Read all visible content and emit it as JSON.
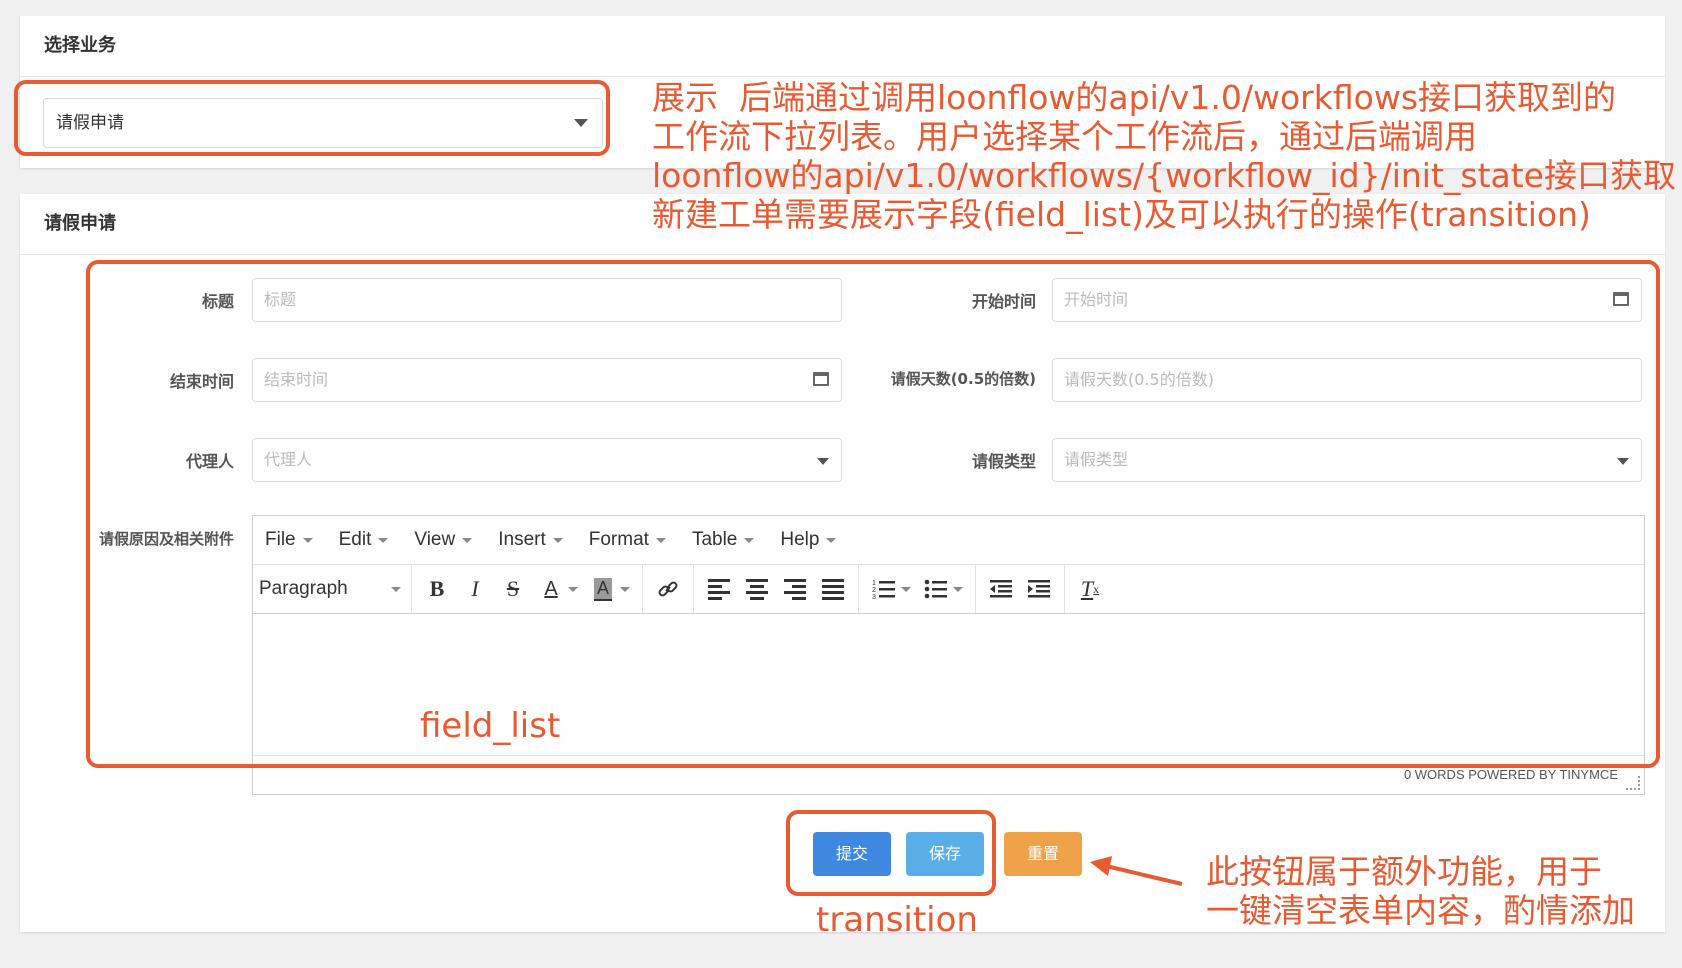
{
  "select_panel": {
    "title": "选择业务",
    "selected_value": "请假申请"
  },
  "form_panel": {
    "title": "请假申请",
    "fields": {
      "title": {
        "label": "标题",
        "placeholder": "标题"
      },
      "start_time": {
        "label": "开始时间",
        "placeholder": "开始时间"
      },
      "end_time": {
        "label": "结束时间",
        "placeholder": "结束时间"
      },
      "leave_days": {
        "label": "请假天数(0.5的倍数)",
        "placeholder": "请假天数(0.5的倍数)"
      },
      "agent": {
        "label": "代理人",
        "placeholder": "代理人"
      },
      "leave_type": {
        "label": "请假类型",
        "placeholder": "请假类型"
      },
      "reason": {
        "label": "请假原因及相关附件"
      }
    },
    "editor": {
      "menus": [
        "File",
        "Edit",
        "View",
        "Insert",
        "Format",
        "Table",
        "Help"
      ],
      "block_format": "Paragraph",
      "status": "0 WORDS POWERED BY TINYMCE"
    },
    "buttons": {
      "submit": "提交",
      "save": "保存",
      "reset": "重置"
    }
  },
  "annotations": {
    "workflow_note": [
      "展示  后端通过调用loonflow的api/v1.0/workflows接口获取到的",
      "工作流下拉列表。用户选择某个工作流后，通过后端调用",
      "loonflow的api/v1.0/workflows/{workflow_id}/init_state接口获取",
      "新建工单需要展示字段(field_list)及可以执行的操作(transition)"
    ],
    "field_list": "field_list",
    "transition": "transition",
    "reset_note": [
      "此按钮属于额外功能，用于",
      "一键清空表单内容，酌情添加"
    ]
  },
  "colors": {
    "annotation": "#e85a32",
    "submit": "#3f88e0",
    "save": "#5aaee8",
    "reset": "#f0a24a"
  }
}
